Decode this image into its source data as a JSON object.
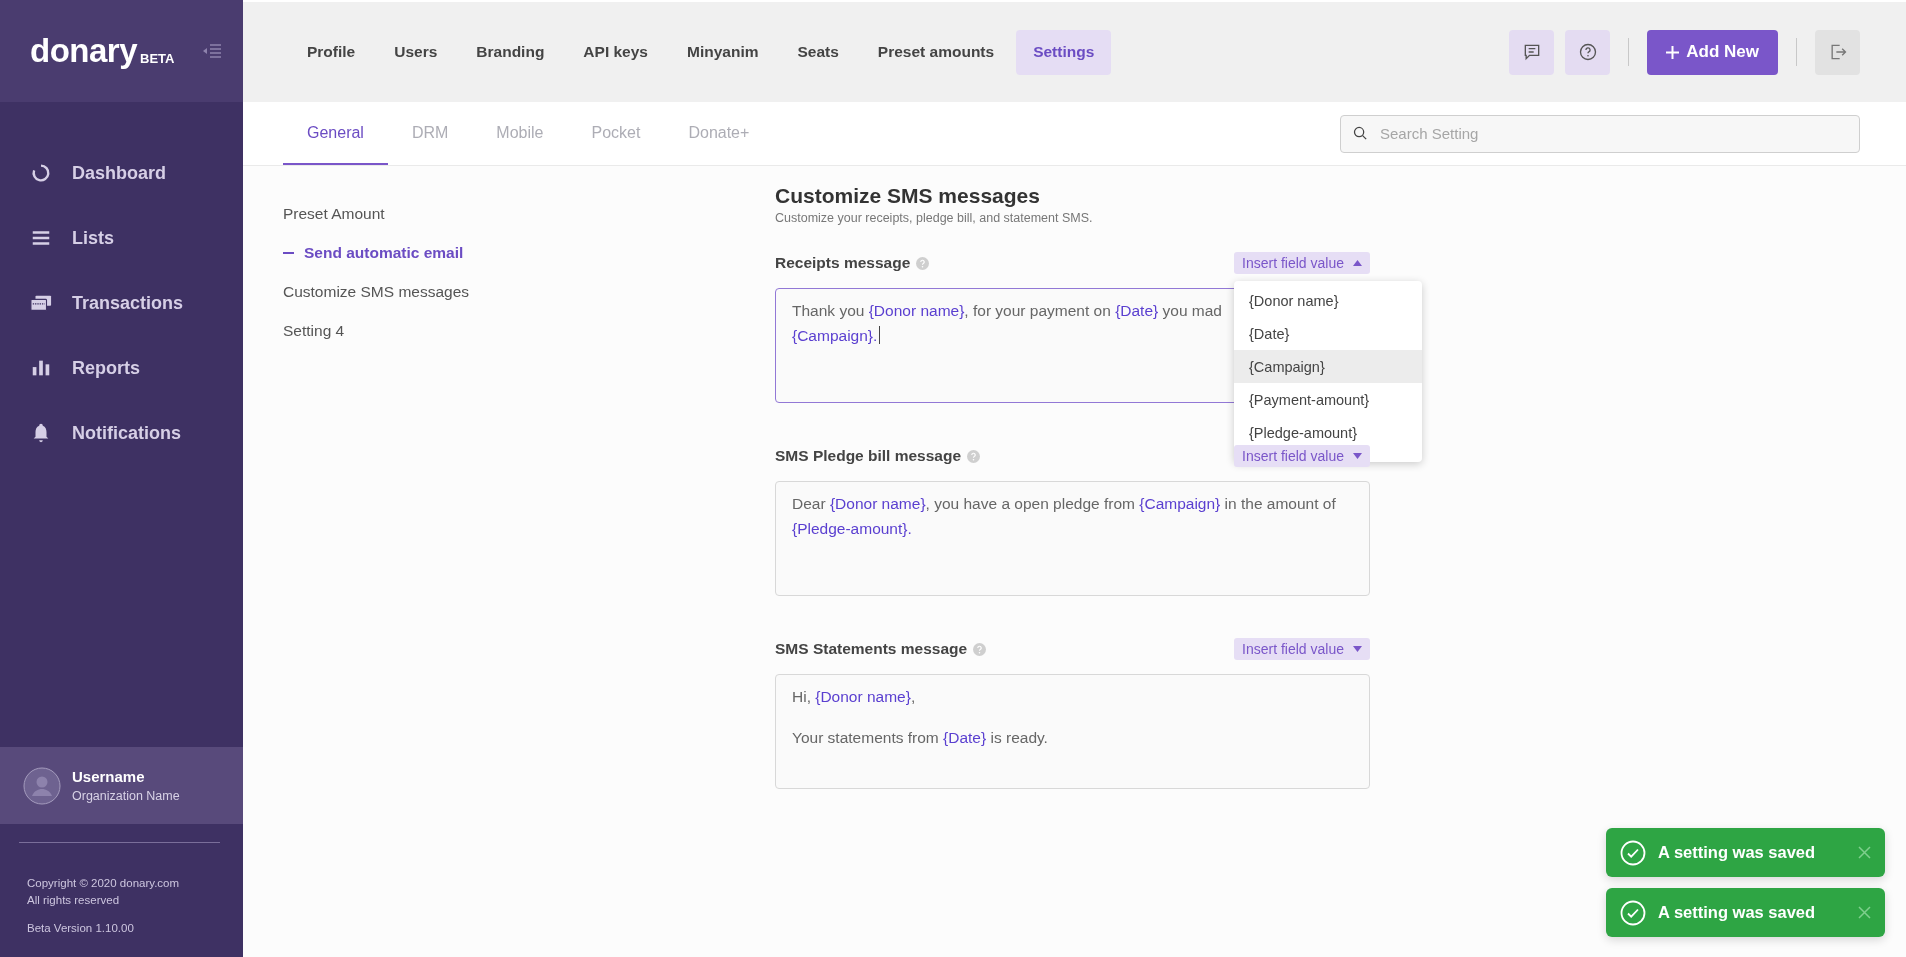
{
  "sidebar": {
    "logo": {
      "text": "donary",
      "badge": "BETA"
    },
    "items": [
      {
        "label": "Dashboard",
        "selected": false
      },
      {
        "label": "Lists",
        "selected": false
      },
      {
        "label": "Transactions",
        "selected": false
      },
      {
        "label": "Reports",
        "selected": false
      },
      {
        "label": "Notifications",
        "selected": false
      }
    ],
    "user": {
      "name": "Username",
      "organization": "Organization Name"
    },
    "footer": {
      "copyright": "Copyright © 2020 donary.com",
      "rights": "All rights reserved",
      "version": "Beta Version 1.10.00"
    }
  },
  "top_nav": {
    "tabs": [
      {
        "label": "Profile",
        "selected": false
      },
      {
        "label": "Users",
        "selected": false
      },
      {
        "label": "Branding",
        "selected": false
      },
      {
        "label": "API keys",
        "selected": false
      },
      {
        "label": "Minyanim",
        "selected": false
      },
      {
        "label": "Seats",
        "selected": false
      },
      {
        "label": "Preset amounts",
        "selected": false
      },
      {
        "label": "Settings",
        "selected": true
      }
    ],
    "add_button": "Add New"
  },
  "sub_tabs": [
    {
      "label": "General",
      "selected": true
    },
    {
      "label": "DRM",
      "selected": false
    },
    {
      "label": "Mobile",
      "selected": false
    },
    {
      "label": "Pocket",
      "selected": false
    },
    {
      "label": "Donate+",
      "selected": false
    }
  ],
  "search": {
    "placeholder": "Search Setting"
  },
  "settings_nav": [
    {
      "label": "Preset Amount",
      "selected": false
    },
    {
      "label": "Send automatic email",
      "selected": true
    },
    {
      "label": "Customize SMS messages",
      "selected": false
    },
    {
      "label": "Setting 4",
      "selected": false
    }
  ],
  "section": {
    "title": "Customize SMS messages",
    "subtitle": "Customize your receipts, pledge bill, and statement SMS.",
    "messages": [
      {
        "label": "Receipts message",
        "insert_button": "Insert field value",
        "expanded": true,
        "focused": true,
        "lines": [
          {
            "kind": "text",
            "segments": [
              {
                "kind": "text",
                "text": "Thank you "
              },
              {
                "kind": "field",
                "text": "{Donor name}"
              },
              {
                "kind": "text",
                "text": ", for your payment on "
              },
              {
                "kind": "field",
                "text": "{Date}"
              },
              {
                "kind": "text",
                "text": " you mad"
              }
            ]
          },
          {
            "kind": "text",
            "segments": [
              {
                "kind": "field",
                "text": "{Campaign}."
              }
            ]
          }
        ],
        "options": [
          {
            "label": "{Donor name}",
            "selected": false
          },
          {
            "label": "{Date}",
            "selected": false
          },
          {
            "label": "{Campaign}",
            "selected": true
          },
          {
            "label": "{Payment-amount}",
            "selected": false
          },
          {
            "label": "{Pledge-amount}",
            "selected": false
          }
        ]
      },
      {
        "label": "SMS Pledge bill message",
        "insert_button": "Insert field value",
        "expanded": false,
        "focused": false,
        "lines": [
          {
            "kind": "text",
            "segments": [
              {
                "kind": "text",
                "text": "Dear "
              },
              {
                "kind": "field",
                "text": "{Donor name}"
              },
              {
                "kind": "text",
                "text": ", you have a open pledge from "
              },
              {
                "kind": "field",
                "text": "{Campaign}"
              },
              {
                "kind": "text",
                "text": " in the amount of "
              },
              {
                "kind": "field",
                "text": "{Pledge-amount}."
              }
            ]
          }
        ]
      },
      {
        "label": "SMS Statements message",
        "insert_button": "Insert field value",
        "expanded": false,
        "focused": false,
        "lines": [
          {
            "kind": "text",
            "segments": [
              {
                "kind": "text",
                "text": "Hi, "
              },
              {
                "kind": "field",
                "text": "{Donor name}"
              },
              {
                "kind": "text",
                "text": ","
              }
            ]
          },
          {
            "kind": "blank"
          },
          {
            "kind": "text",
            "segments": [
              {
                "kind": "text",
                "text": "Your statements from "
              },
              {
                "kind": "field",
                "text": "{Date}"
              },
              {
                "kind": "text",
                "text": " is ready."
              }
            ]
          }
        ]
      }
    ]
  },
  "toasts": [
    {
      "message": "A setting was saved"
    },
    {
      "message": "A setting was saved"
    }
  ]
}
